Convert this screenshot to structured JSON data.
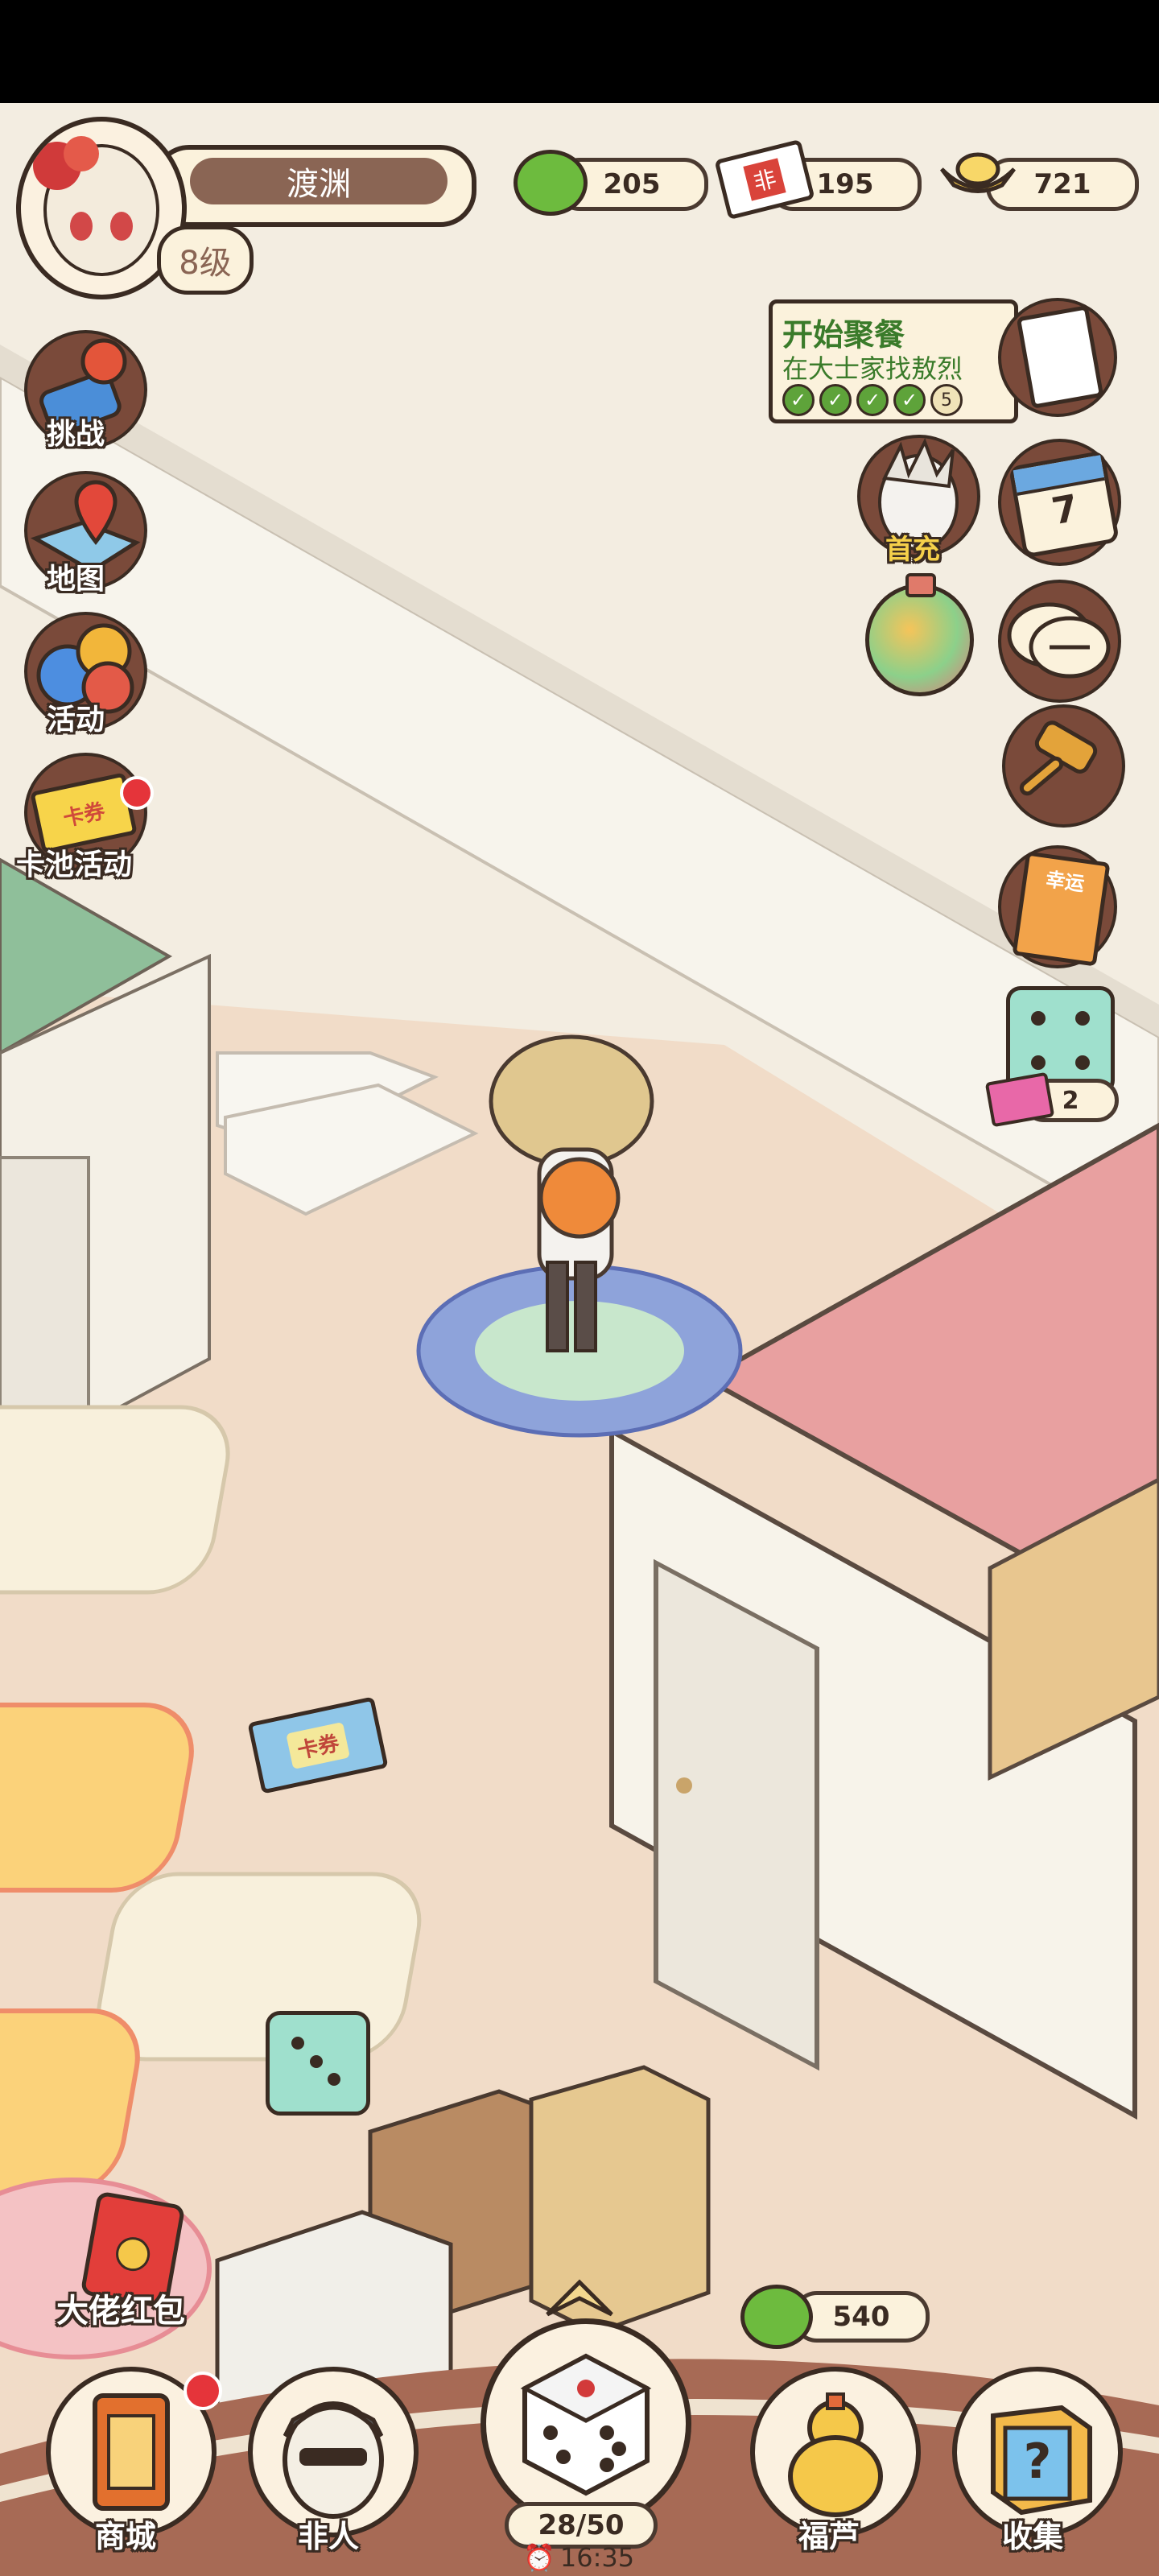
{
  "player": {
    "name": "渡渊",
    "level": "8级"
  },
  "currencies": [
    {
      "icon": "green-swirl-coin-icon",
      "value": "205"
    },
    {
      "icon": "ticket-icon",
      "value": "195",
      "icon_text": "非"
    },
    {
      "icon": "gold-ingot-icon",
      "value": "721"
    }
  ],
  "quest": {
    "title": "开始聚餐",
    "subtitle": "在大士家找敖烈",
    "progress_num": "5"
  },
  "left_menu": [
    {
      "label": "挑战",
      "icon": "joystick-icon"
    },
    {
      "label": "地图",
      "icon": "map-pin-icon"
    },
    {
      "label": "活动",
      "icon": "balloons-icon"
    },
    {
      "label": "卡池活动",
      "icon": "card-ticket-icon",
      "icon_text": "卡券"
    }
  ],
  "right_menu": {
    "first_recharge_label": "首充",
    "calendar_day": "7",
    "lucky_card_text": "幸运",
    "dice_count": "2"
  },
  "board": {
    "ticket_text": "卡券"
  },
  "red_packet_label": "大佬红包",
  "bottom_currency": {
    "icon": "green-swirl-coin-icon",
    "value": "540"
  },
  "bottom_nav": [
    {
      "label": "商城",
      "icon": "shop-icon"
    },
    {
      "label": "非人",
      "icon": "character-icon"
    },
    {
      "label": "福芦",
      "icon": "gourd-icon"
    },
    {
      "label": "收集",
      "icon": "mystery-box-icon"
    }
  ],
  "dice": {
    "count": "28/50",
    "timer": "16:35"
  },
  "colors": {
    "accent_green": "#5ea33a",
    "outline": "#3a2b22",
    "pill_bg": "#fbf2dc",
    "pink_room": "#e8a0a0",
    "green_room": "#8fbf9a"
  }
}
